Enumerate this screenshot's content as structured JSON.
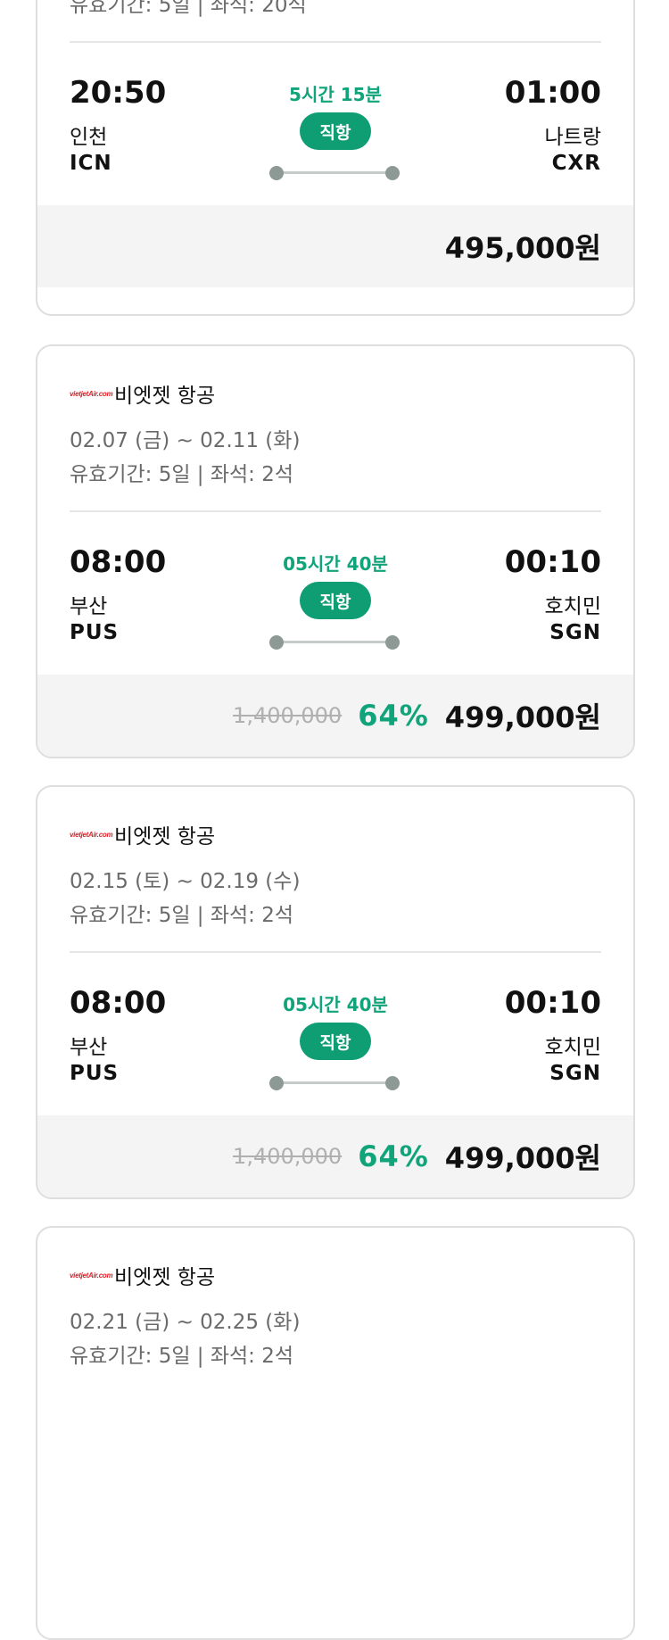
{
  "flights": [
    {
      "dates": "",
      "validity": "유효기간: 5일 | 좌석: 20석",
      "dep_time": "20:50",
      "dep_city": "인천",
      "dep_code": "ICN",
      "duration": "5시간 15분",
      "direct_label": "직항",
      "arr_time": "01:00",
      "arr_city": "나트랑",
      "arr_code": "CXR",
      "original_price": "",
      "discount": "",
      "price": "495,000원"
    },
    {
      "airline_logo": "vietjetAir.com",
      "airline_name": "비엣젯 항공",
      "dates": "02.07 (금) ~ 02.11 (화)",
      "validity": "유효기간: 5일 | 좌석: 2석",
      "dep_time": "08:00",
      "dep_city": "부산",
      "dep_code": "PUS",
      "duration": "05시간 40분",
      "direct_label": "직항",
      "arr_time": "00:10",
      "arr_city": "호치민",
      "arr_code": "SGN",
      "original_price": "1,400,000",
      "discount": "64%",
      "price": "499,000원"
    },
    {
      "airline_logo": "vietjetAir.com",
      "airline_name": "비엣젯 항공",
      "dates": "02.15 (토) ~ 02.19 (수)",
      "validity": "유효기간: 5일 | 좌석: 2석",
      "dep_time": "08:00",
      "dep_city": "부산",
      "dep_code": "PUS",
      "duration": "05시간 40분",
      "direct_label": "직항",
      "arr_time": "00:10",
      "arr_city": "호치민",
      "arr_code": "SGN",
      "original_price": "1,400,000",
      "discount": "64%",
      "price": "499,000원"
    },
    {
      "airline_logo": "vietjetAir.com",
      "airline_name": "비엣젯 항공",
      "dates": "02.21 (금) ~ 02.25 (화)",
      "validity": "유효기간: 5일 | 좌석: 2석",
      "dep_time": "",
      "dep_city": "",
      "dep_code": "",
      "duration": "",
      "direct_label": "",
      "arr_time": "",
      "arr_city": "",
      "arr_code": "",
      "original_price": "",
      "discount": "",
      "price": ""
    }
  ],
  "colors": {
    "accent": "#11a37a",
    "badge": "#0f9d74",
    "price_bar": "#f4f4f4",
    "airline_logo": "#e21d25"
  }
}
